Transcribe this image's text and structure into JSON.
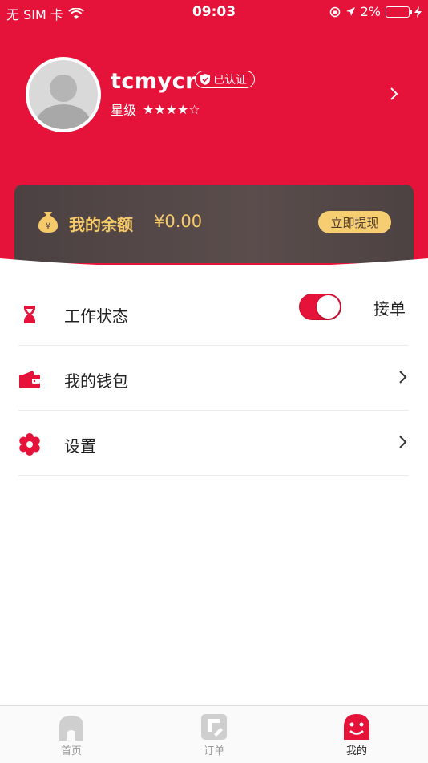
{
  "status_bar": {
    "carrier": "无 SIM 卡",
    "time": "09:03",
    "battery": "2%"
  },
  "profile": {
    "username": "tcmycr",
    "verified_label": "已认证",
    "level_label": "星级",
    "stars": "★★★★☆",
    "rating": 4,
    "rating_max": 5
  },
  "balance": {
    "label": "我的余额",
    "value": "¥0.00",
    "icon": "money-bag-icon",
    "withdraw_label": "立即提现"
  },
  "menu": {
    "work_status": {
      "label": "工作状态",
      "toggle_on": true,
      "toggle_text": "接单",
      "icon": "hourglass-icon"
    },
    "wallet": {
      "label": "我的钱包",
      "icon": "wallet-icon"
    },
    "settings": {
      "label": "设置",
      "icon": "gear-icon"
    }
  },
  "tabbar": {
    "items": [
      {
        "label": "首页",
        "icon": "home-icon",
        "active": false
      },
      {
        "label": "订单",
        "icon": "order-icon",
        "active": false
      },
      {
        "label": "我的",
        "icon": "smiley-icon",
        "active": true
      }
    ]
  },
  "colors": {
    "primary_red": "#e5133a",
    "card_bg": "#4f4445",
    "gold": "#f6c969",
    "button_gold": "#f7cd72"
  }
}
